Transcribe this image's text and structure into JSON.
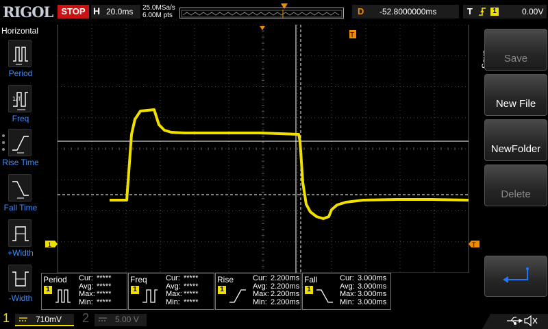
{
  "brand": "RIGOL",
  "run_state": "STOP",
  "horizontal": {
    "letter": "H",
    "scale": "20.0ms"
  },
  "acquisition": {
    "sample_rate": "25.0MSa/s",
    "memory_depth": "6.00M pts"
  },
  "delay": {
    "letter": "D",
    "value": "-52.8000000ms"
  },
  "trigger": {
    "letter": "T",
    "edge": "rising",
    "source": "1",
    "level": "0.00V"
  },
  "left_panel": {
    "title": "Horizontal",
    "items": [
      {
        "label": "Period",
        "icon": "period-icon"
      },
      {
        "label": "Freq",
        "icon": "frequency-icon"
      },
      {
        "label": "Rise Time",
        "icon": "rise-time-icon"
      },
      {
        "label": "Fall Time",
        "icon": "fall-time-icon"
      },
      {
        "label": "+Width",
        "icon": "positive-width-icon"
      },
      {
        "label": "-Width",
        "icon": "negative-width-icon"
      }
    ]
  },
  "menu": {
    "title": "Save",
    "softkeys": [
      {
        "label": "Save",
        "enabled": false
      },
      {
        "label": "New File",
        "enabled": true
      },
      {
        "label": "NewFolder",
        "enabled": true
      },
      {
        "label": "Delete",
        "enabled": false
      }
    ],
    "enter_icon": "enter-icon"
  },
  "markers": {
    "trigger_position": "T",
    "channel1_ground": "1",
    "trigger_level": "T"
  },
  "measurements": [
    {
      "name": "Period",
      "channel": "1",
      "icon": "period-icon",
      "stats": [
        {
          "k": "Cur:",
          "v": "*****"
        },
        {
          "k": "Avg:",
          "v": "*****"
        },
        {
          "k": "Max:",
          "v": "*****"
        },
        {
          "k": "Min:",
          "v": "*****"
        }
      ]
    },
    {
      "name": "Freq",
      "channel": "1",
      "icon": "frequency-icon",
      "stats": [
        {
          "k": "Cur:",
          "v": "*****"
        },
        {
          "k": "Avg:",
          "v": "*****"
        },
        {
          "k": "Max:",
          "v": "*****"
        },
        {
          "k": "Min:",
          "v": "*****"
        }
      ]
    },
    {
      "name": "Rise",
      "channel": "1",
      "icon": "rise-time-icon",
      "stats": [
        {
          "k": "Cur:",
          "v": "2.200ms"
        },
        {
          "k": "Avg:",
          "v": "2.200ms"
        },
        {
          "k": "Max:",
          "v": "2.200ms"
        },
        {
          "k": "Min:",
          "v": "2.200ms"
        }
      ]
    },
    {
      "name": "Fall",
      "channel": "1",
      "icon": "fall-time-icon",
      "stats": [
        {
          "k": "Cur:",
          "v": "3.000ms"
        },
        {
          "k": "Avg:",
          "v": "3.000ms"
        },
        {
          "k": "Max:",
          "v": "3.000ms"
        },
        {
          "k": "Min:",
          "v": "3.000ms"
        }
      ]
    }
  ],
  "channels": [
    {
      "number": "1",
      "scale": "710mV",
      "active": true
    },
    {
      "number": "2",
      "scale": "5.00 V",
      "active": false
    }
  ],
  "status_icons": [
    "usb-icon",
    "speaker-muted-icon"
  ],
  "colors": {
    "channel1": "#f0e000",
    "trigger": "#f08c00",
    "stop": "#c81414",
    "label_blue": "#3c8cff"
  }
}
